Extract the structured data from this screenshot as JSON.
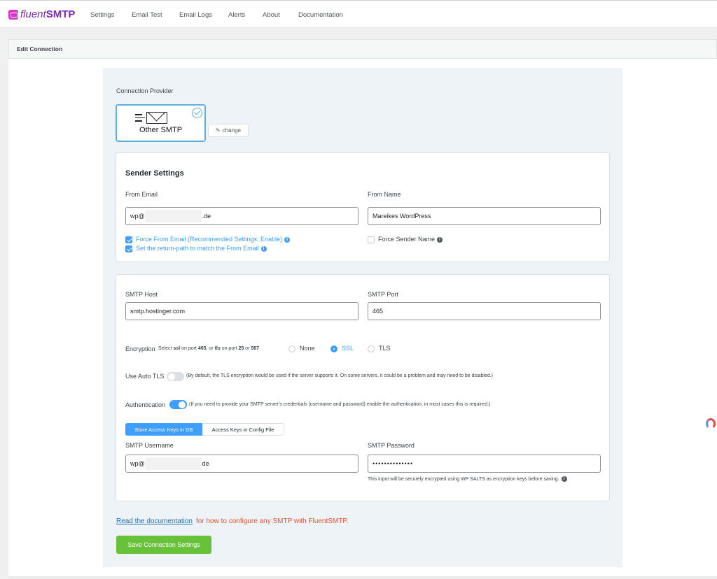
{
  "brand": {
    "name_regular": "fluent",
    "name_bold": "SMTP"
  },
  "nav": [
    "Settings",
    "Email Test",
    "Email Logs",
    "Alerts",
    "About",
    "Documentation"
  ],
  "page": {
    "title": "Edit Connection"
  },
  "provider": {
    "section_label": "Connection Provider",
    "selected": "Other SMTP",
    "change_label": "change"
  },
  "sender": {
    "title": "Sender Settings",
    "from_email_label": "From Email",
    "from_email_prefix": "wp@",
    "from_email_suffix": ".de",
    "from_name_label": "From Name",
    "from_name_value": "Mareikes WordPress",
    "force_from_email_label": "Force From Email (Recommended Settings: Enable)",
    "force_from_email_checked": true,
    "return_path_label": "Set the return-path to match the From Email",
    "return_path_checked": true,
    "force_sender_name_label": "Force Sender Name",
    "force_sender_name_checked": false
  },
  "smtp": {
    "host_label": "SMTP Host",
    "host_value": "smtp.hostinger.com",
    "port_label": "SMTP Port",
    "port_value": "465",
    "encryption_label": "Encryption",
    "encryption_hint_1": "Select ",
    "encryption_hint_ssl": "ssl",
    "encryption_hint_2": " on port ",
    "encryption_hint_465": "465",
    "encryption_hint_3": ", or ",
    "encryption_hint_tls": "tls",
    "encryption_hint_4": " on port ",
    "encryption_hint_25": "25",
    "encryption_hint_5": " or ",
    "encryption_hint_587": "587",
    "encryption_options": [
      "None",
      "SSL",
      "TLS"
    ],
    "encryption_selected": "SSL",
    "auto_tls_label": "Use Auto TLS",
    "auto_tls_on": false,
    "auto_tls_hint": "(By default, the TLS encryption would be used if the server supports it. On some servers, it could be a problem and may need to be disabled.)",
    "auth_label": "Authentication",
    "auth_on": true,
    "auth_hint": "(If you need to provide your SMTP server's credentials (username and password) enable the authentication, in most cases this is required.)",
    "key_storage_options": [
      "Store Access Keys in DB",
      "Access Keys in Config File"
    ],
    "key_storage_selected": "Store Access Keys in DB",
    "username_label": "SMTP Username",
    "username_prefix": "wp@",
    "username_suffix": "de",
    "password_label": "SMTP Password",
    "password_value": "••••••••••••••",
    "password_hint": "This input will be securely encrypted using WP SALTS as encryption keys before saving."
  },
  "footer": {
    "doc_link": "Read the documentation",
    "doc_text": " for how to configure any SMTP with FluentSMTP.",
    "save_label": "Save Connection Settings"
  },
  "colors": {
    "accent": "#409eff",
    "save": "#67c23a",
    "doc_text": "#e8522f",
    "brand": "#7a2ab2"
  }
}
